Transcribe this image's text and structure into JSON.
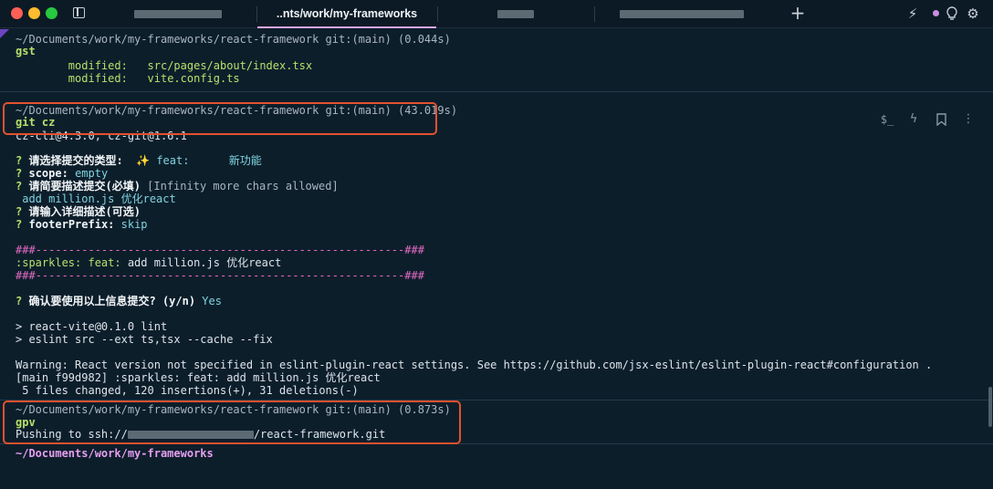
{
  "titlebar": {
    "tabs": [
      {
        "label": ""
      },
      {
        "label": "..nts/work/my-frameworks"
      },
      {
        "label": ""
      },
      {
        "label": ""
      }
    ],
    "new_tab_label": "+"
  },
  "colors": {
    "background": "#0d1e2b",
    "accent": "#d6a7e8",
    "highlight_box": "#e2522e",
    "prompt": "#e69ef0",
    "green": "#b8e06a"
  },
  "icons": {
    "new_tab": "plus-icon",
    "warp_ai": "bolt-icon",
    "notifications": "dot-icon",
    "tips": "lightbulb-icon",
    "settings": "gear-icon",
    "block_tools": [
      "dollar-icon",
      "bolt-icon",
      "bookmark-icon",
      "more-icon"
    ]
  },
  "block1": {
    "header": "~/Documents/work/my-frameworks/react-framework git:(main) (0.044s)",
    "command": "gst",
    "output": [
      {
        "label": "modified:",
        "path": "src/pages/about/index.tsx"
      },
      {
        "label": "modified:",
        "path": "vite.config.ts"
      }
    ]
  },
  "block2": {
    "header": "~/Documents/work/my-frameworks/react-framework git:(main) (43.019s)",
    "command": "git cz",
    "version": "cz-cli@4.3.0, cz-git@1.6.1",
    "q1_prefix": "?",
    "q1_label": "请选择提交的类型:",
    "q1_answer": "✨ feat:      新功能",
    "q2_prefix": "?",
    "q2_label": "scope:",
    "q2_answer": "empty",
    "q3_prefix": "?",
    "q3_label": "请简要描述提交(必填)",
    "q3_hint": "[Infinity more chars allowed]",
    "q3_answer": " add million.js 优化react",
    "q4_prefix": "?",
    "q4_label": "请输入详细描述(可选)",
    "q5_prefix": "?",
    "q5_label": "footerPrefix:",
    "q5_answer": "skip",
    "rule_top": "###--------------------------------------------------------###",
    "summary_prefix": ":sparkles: feat:",
    "summary_text": "add million.js 优化react",
    "rule_bottom": "###--------------------------------------------------------###",
    "confirm_prefix": "?",
    "confirm_label": "确认要使用以上信息提交?",
    "confirm_choice": "(y/n)",
    "confirm_answer": "Yes",
    "lint_1": "> react-vite@0.1.0 lint",
    "lint_2": "> eslint src --ext ts,tsx --cache --fix",
    "warning": "Warning: React version not specified in eslint-plugin-react settings. See https://github.com/jsx-eslint/eslint-plugin-react#configuration .",
    "commit_result": "[main f99d982] :sparkles: feat: add million.js 优化react",
    "stats": " 5 files changed, 120 insertions(+), 31 deletions(-)"
  },
  "block3": {
    "header": "~/Documents/work/my-frameworks/react-framework git:(main) (0.873s)",
    "command": "gpv",
    "output_prefix": "Pushing to ssh://",
    "output_suffix": "/react-framework.git"
  },
  "prompt": {
    "cwd": "~/Documents/work/my-frameworks"
  }
}
